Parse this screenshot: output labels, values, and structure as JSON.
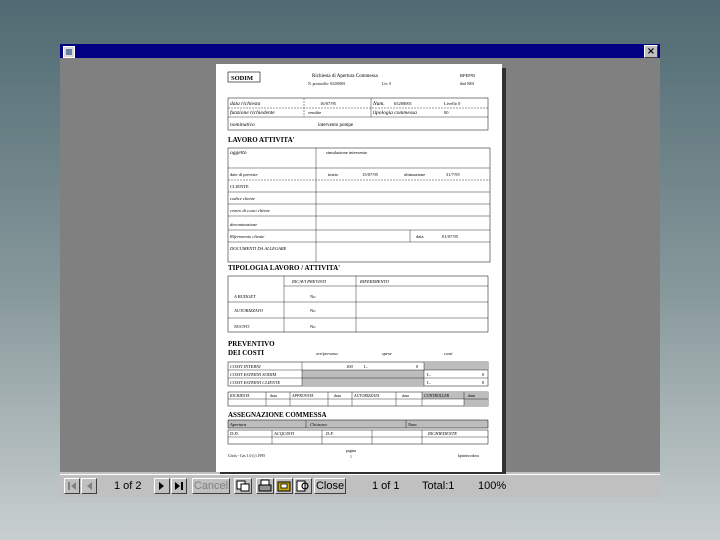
{
  "window": {
    "close_glyph": "×"
  },
  "toolbar": {
    "page_indicator": "1 of 2",
    "cancel_label": "Cancel",
    "close_label": "Close",
    "records": "1 of 1",
    "total": "Total:1",
    "zoom": "100%",
    "icons": [
      "first-page-icon",
      "prev-page-icon",
      "next-page-icon",
      "last-page-icon",
      "export-icon",
      "print-icon",
      "print-setup-icon",
      "search-icon"
    ]
  },
  "document": {
    "logo": "SODIM",
    "header_title": "Richiesta di Apertura Commessa",
    "header_num": "RPEP95",
    "header_line2_a": "N. protocollo: 65200001",
    "header_line2_b": "Liv: 0",
    "header_line2_c": "ibid 0001",
    "data_richiesta_lbl": "data richiesta",
    "data_richiesta_val": "16/07/95",
    "num_lbl": "Num.",
    "num_val": "65200001",
    "livello": "Livello 0",
    "funzione_lbl": "funzione richiedente",
    "funzione_val": "vendite",
    "tipologia_lbl": "tipologia commessa",
    "tipologia_val": "00",
    "nominativo_lbl": "nominativo",
    "nominativo_val": "intervento pompe",
    "lavoro_title": "LAVORO ATTIVITA'",
    "oggetto_lbl": "oggetto",
    "oggetto_val": "simulazione intervento",
    "date_prev_lbl": "date di previste",
    "inizio_lbl": "inizio",
    "inizio_val": "15/07/95",
    "ultimazione_lbl": "ultimazione",
    "ultimazione_val": "31/7/95",
    "cliente_lbl": "CLIENTE",
    "codice_lbl": "codice cliente",
    "centro_lbl": "centro di costo cliente",
    "denominazione_lbl": "denominazione",
    "riferimento_lbl": "Riferimento cliente",
    "data_lbl": "data",
    "data_val": "01/07/95",
    "documenti_lbl": "DOCUMENTI DA ALLEGARE",
    "tipologia_title": "TIPOLOGIA LAVORO / ATTIVITA'",
    "ricavi_lbl": "RICAVI PREVISTI",
    "riferimento2_lbl": "RIFERIMENTO",
    "rows": [
      {
        "label": "A BUDGET",
        "value": "No"
      },
      {
        "label": "AUTORIZZATO",
        "value": "No"
      },
      {
        "label": "NUOVO",
        "value": "No"
      }
    ],
    "preventivo_title_1": "PREVENTIVO",
    "preventivo_title_2": "DEI COSTI",
    "col_ore": "ore/persona",
    "col_spese": "spese",
    "col_costi": "costi",
    "costi_interni": "COSTI INTERNI",
    "costi_interni_val": "100",
    "costi_l": "L.",
    "costi_zero": "0",
    "costi_sodim": "COSTI ESTERNI SODIM",
    "costi_cliente": "COSTI ESTERNI CLIENTE",
    "sign_headers": [
      "RICHIESTA",
      "data",
      "APPROVATA",
      "data",
      "AUTORIZZATA",
      "data",
      "CONTROLLER",
      "data"
    ],
    "assegnazione_title": "ASSEGNAZIONE COMMESSA",
    "aperture_lbl": "Apertura",
    "chiusura_lbl": "Chiusura",
    "num2_lbl": "Num.",
    "dd_lbl": "D.D.",
    "acquisti_lbl": "ACQUISTI",
    "df_lbl": "D.F.",
    "richiedente_lbl": "RICHIEDENTE",
    "footer_left": "Citrix - Cas 1.0 (c) 1995",
    "footer_page": "pagina",
    "footer_page_num": "1",
    "footer_right": "kprintwodocu"
  }
}
